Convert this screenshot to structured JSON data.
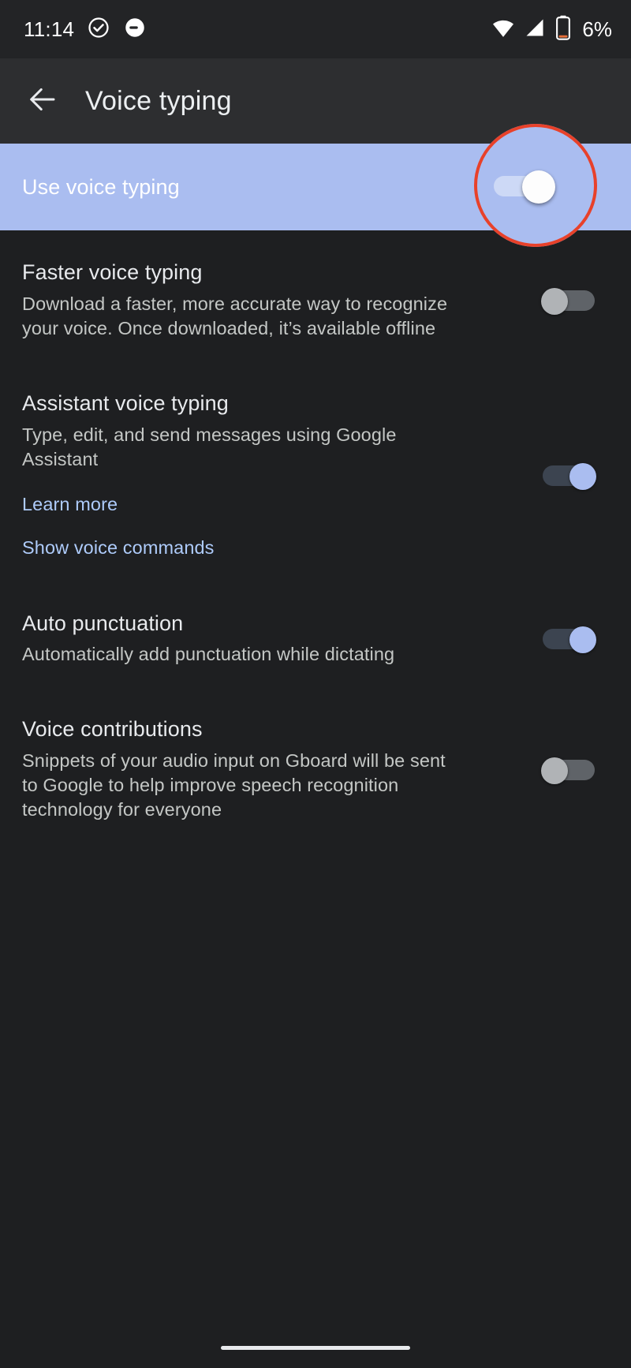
{
  "status_bar": {
    "time": "11:14",
    "icons": [
      "check-circle-icon",
      "do-not-disturb-icon",
      "wifi-icon",
      "cellular-signal-icon",
      "battery-icon"
    ],
    "battery_percent": "6%"
  },
  "app_bar": {
    "back_icon": "back-arrow-icon",
    "title": "Voice typing"
  },
  "settings": [
    {
      "title": "Use voice typing",
      "summary": "",
      "toggle": "on",
      "highlighted": true
    },
    {
      "title": "Faster voice typing",
      "summary": "Download a faster, more accurate way to recognize your voice. Once downloaded, it’s available offline",
      "toggle": "off",
      "highlighted": false
    },
    {
      "title": "Assistant voice typing",
      "summary": "Type, edit, and send messages using Google Assistant",
      "toggle": "on",
      "highlighted": false,
      "links": [
        "Learn more",
        "Show voice commands"
      ]
    },
    {
      "title": "Auto punctuation",
      "summary": "Automatically add punctuation while dictating",
      "toggle": "on",
      "highlighted": false
    },
    {
      "title": "Voice contributions",
      "summary": "Snippets of your audio input on Gboard will be sent to Google to help improve speech recognition technology for everyone",
      "toggle": "off",
      "highlighted": false
    }
  ],
  "annotation": {
    "type": "highlight-circle",
    "color": "#e8412a",
    "target": "use-voice-typing-switch"
  },
  "nav_bar": {
    "gesture_pill": "home-gesture-pill"
  },
  "colors": {
    "background": "#1e1f21",
    "app_bar": "#2d2e30",
    "status_bar": "#232426",
    "highlight": "#aabdf0",
    "accent": "#aabdf0",
    "link": "#aecbfa",
    "annotation": "#e8412a",
    "title_text": "#e8eaed",
    "summary_text": "#c4c7c5"
  }
}
